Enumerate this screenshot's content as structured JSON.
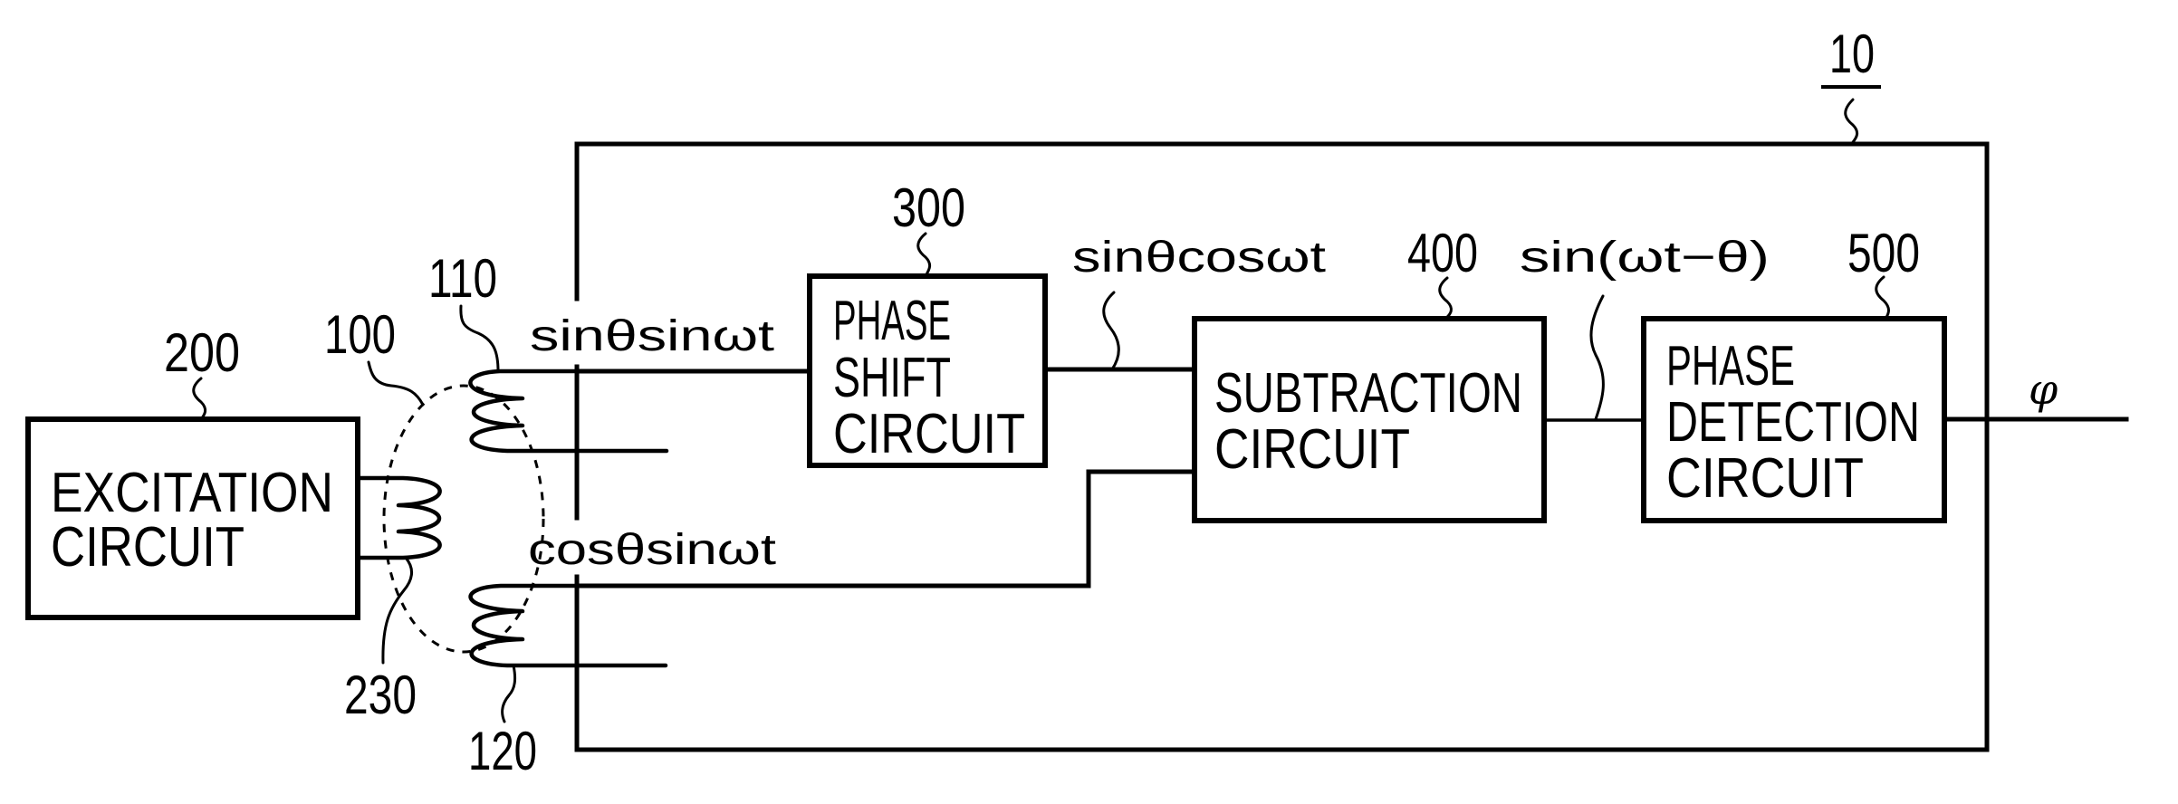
{
  "figure": {
    "reference": "10",
    "output_label": "φ"
  },
  "blocks": {
    "excitation": {
      "ref": "200",
      "line1": "EXCITATION",
      "line2": "CIRCUIT"
    },
    "phase_shift": {
      "ref": "300",
      "line1": "PHASE",
      "line2": "SHIFT",
      "line3": "CIRCUIT"
    },
    "subtraction": {
      "ref": "400",
      "line1": "SUBTRACTION",
      "line2": "CIRCUIT"
    },
    "phase_detection": {
      "ref": "500",
      "line1": "PHASE",
      "line2": "DETECTION",
      "line3": "CIRCUIT"
    }
  },
  "components": {
    "resolver": {
      "ref": "100"
    },
    "sine_coil": {
      "ref": "110"
    },
    "cosine_coil": {
      "ref": "120"
    },
    "excitation_coil": {
      "ref": "230"
    }
  },
  "signals": {
    "sine_output": "sinθsinωt",
    "cosine_output": "cosθsinωt",
    "phase_shifted": "sinθcosωt",
    "difference": "sin(ωt−θ)"
  }
}
